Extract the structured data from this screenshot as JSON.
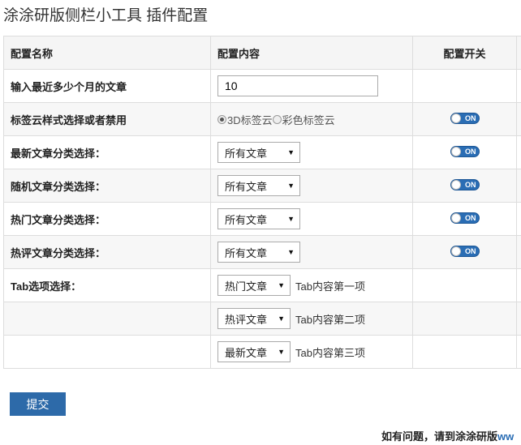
{
  "page_title": "涂涂研版侧栏小工具 插件配置",
  "table": {
    "headers": {
      "name": "配置名称",
      "content": "配置内容",
      "switch": "配置开关"
    },
    "rows": [
      {
        "name": "输入最近多少个月的文章",
        "input_value": "10"
      },
      {
        "name": "标签云样式选择或者禁用",
        "radio_options": [
          "3D标签云",
          "彩色标签云"
        ],
        "radio_selected": "3D标签云",
        "switch": "ON"
      },
      {
        "name": "最新文章分类选择：",
        "select_value": "所有文章",
        "switch": "ON"
      },
      {
        "name": "随机文章分类选择：",
        "select_value": "所有文章",
        "switch": "ON"
      },
      {
        "name": "热门文章分类选择：",
        "select_value": "所有文章",
        "switch": "ON"
      },
      {
        "name": "热评文章分类选择：",
        "select_value": "所有文章",
        "switch": "ON"
      },
      {
        "name": "Tab选项选择：",
        "select_value": "热门文章",
        "note": "Tab内容第一项"
      },
      {
        "name": "",
        "select_value": "热评文章",
        "note": "Tab内容第二项"
      },
      {
        "name": "",
        "select_value": "最新文章",
        "note": "Tab内容第三项"
      }
    ]
  },
  "submit_label": "提交",
  "footer": {
    "text": "如有问题，请到涂涂研版",
    "link_text": "ww"
  },
  "icons": {
    "dropdown": "triangle-down-icon"
  },
  "colors": {
    "accent": "#2a6db4",
    "button": "#2d6aa9"
  }
}
